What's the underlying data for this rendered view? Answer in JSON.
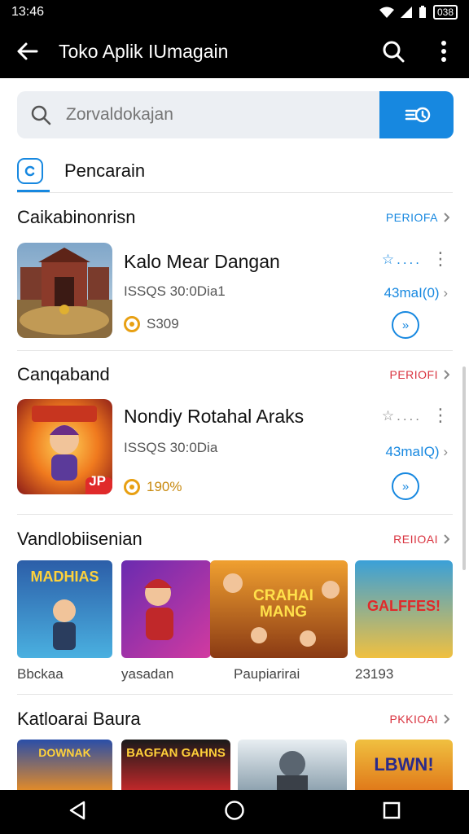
{
  "status": {
    "time": "13:46",
    "battery": "038"
  },
  "appbar": {
    "title": "Toko Aplik IUmagain"
  },
  "search": {
    "placeholder": "Zorvaldokajan"
  },
  "tab": {
    "label": "Pencarain"
  },
  "sections": [
    {
      "title": "Caikabinonrisn",
      "link": "PERIOFA",
      "link_color": "#1788e0",
      "app": {
        "name": "Kalo Mear Dangan",
        "sub": "ISSQS 30:0Dia1",
        "price": "S309",
        "size": "43maI(0)"
      }
    },
    {
      "title": "Canqaband",
      "link": "PERIOFI",
      "link_color": "#d9333f",
      "app": {
        "name": "Nondiy Rotahal Araks",
        "sub": "ISSQS 30:0Dia",
        "price": "190%",
        "size": "43maIQ)",
        "badge": "JP"
      }
    },
    {
      "title": "Vandlobiisenian",
      "link": "REIIOAI",
      "link_color": "#d9333f",
      "grid": [
        {
          "label": "Bbckaa",
          "art": "MADHIAS"
        },
        {
          "label": "yasadan",
          "art": ""
        },
        {
          "label": "Paupiarirai",
          "art": "CRAHAI MANG"
        },
        {
          "label": "23193",
          "art": "GALFFES!"
        }
      ]
    },
    {
      "title": "Katloarai Baura",
      "link": "PKKIOAI",
      "link_color": "#d9333f",
      "bottom_art": [
        "DOWNAK",
        "BAGFAN GAHNS",
        "",
        "LBWN!"
      ]
    }
  ],
  "colors": {
    "accent": "#1788e0",
    "link_red": "#d9333f",
    "coin": "#e8a013"
  },
  "icons": [
    "back-arrow-icon",
    "search-icon",
    "more-vert-icon",
    "filter-icon",
    "tab-icon",
    "chevron-right-icon",
    "star-icon",
    "download-icon",
    "coin-icon",
    "nav-back-icon",
    "nav-home-icon",
    "nav-recents-icon"
  ]
}
